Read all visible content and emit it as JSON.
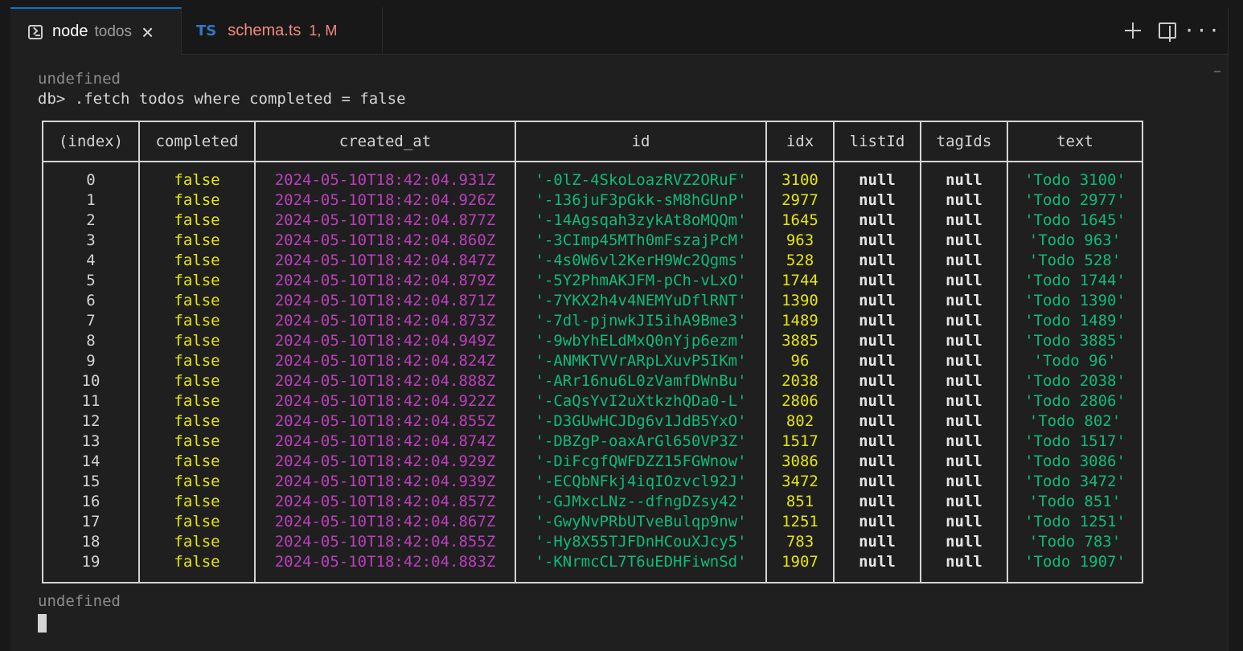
{
  "tabs": [
    {
      "title": "node",
      "description": "todos",
      "icon": "terminal-icon",
      "active": true
    },
    {
      "badge": "TS",
      "title": "schema.ts",
      "status": "1, M",
      "icon": "typescript-icon",
      "active": false
    }
  ],
  "actions": {
    "new": "new-terminal-icon",
    "split": "split-editor-icon",
    "more": "more-actions-icon"
  },
  "terminal": {
    "line1": "undefined",
    "command_line": "db> .fetch todos where completed = false",
    "result_line": "undefined",
    "table": {
      "headers": [
        "(index)",
        "completed",
        "created_at",
        "id",
        "idx",
        "listId",
        "tagIds",
        "text"
      ],
      "rows": [
        [
          "0",
          "false",
          "2024-05-10T18:42:04.931Z",
          "'-0lZ-4SkoLoazRVZ2ORuF'",
          "3100",
          "null",
          "null",
          "'Todo 3100'"
        ],
        [
          "1",
          "false",
          "2024-05-10T18:42:04.926Z",
          "'-136juF3pGkk-sM8hGUnP'",
          "2977",
          "null",
          "null",
          "'Todo 2977'"
        ],
        [
          "2",
          "false",
          "2024-05-10T18:42:04.877Z",
          "'-14Agsqah3zykAt8oMQQm'",
          "1645",
          "null",
          "null",
          "'Todo 1645'"
        ],
        [
          "3",
          "false",
          "2024-05-10T18:42:04.860Z",
          "'-3CImp45MTh0mFszajPcM'",
          "963",
          "null",
          "null",
          "'Todo 963'"
        ],
        [
          "4",
          "false",
          "2024-05-10T18:42:04.847Z",
          "'-4s0W6vl2KerH9Wc2Qgms'",
          "528",
          "null",
          "null",
          "'Todo 528'"
        ],
        [
          "5",
          "false",
          "2024-05-10T18:42:04.879Z",
          "'-5Y2PhmAKJFM-pCh-vLxO'",
          "1744",
          "null",
          "null",
          "'Todo 1744'"
        ],
        [
          "6",
          "false",
          "2024-05-10T18:42:04.871Z",
          "'-7YKX2h4v4NEMYuDflRNT'",
          "1390",
          "null",
          "null",
          "'Todo 1390'"
        ],
        [
          "7",
          "false",
          "2024-05-10T18:42:04.873Z",
          "'-7dl-pjnwkJI5ihA9Bme3'",
          "1489",
          "null",
          "null",
          "'Todo 1489'"
        ],
        [
          "8",
          "false",
          "2024-05-10T18:42:04.949Z",
          "'-9wbYhELdMxQ0nYjp6ezm'",
          "3885",
          "null",
          "null",
          "'Todo 3885'"
        ],
        [
          "9",
          "false",
          "2024-05-10T18:42:04.824Z",
          "'-ANMKTVVrARpLXuvP5IKm'",
          "96",
          "null",
          "null",
          "'Todo 96'"
        ],
        [
          "10",
          "false",
          "2024-05-10T18:42:04.888Z",
          "'-ARr16nu6L0zVamfDWnBu'",
          "2038",
          "null",
          "null",
          "'Todo 2038'"
        ],
        [
          "11",
          "false",
          "2024-05-10T18:42:04.922Z",
          "'-CaQsYvI2uXtkzhQDa0-L'",
          "2806",
          "null",
          "null",
          "'Todo 2806'"
        ],
        [
          "12",
          "false",
          "2024-05-10T18:42:04.855Z",
          "'-D3GUwHCJDg6v1JdB5YxO'",
          "802",
          "null",
          "null",
          "'Todo 802'"
        ],
        [
          "13",
          "false",
          "2024-05-10T18:42:04.874Z",
          "'-DBZgP-oaxArGl650VP3Z'",
          "1517",
          "null",
          "null",
          "'Todo 1517'"
        ],
        [
          "14",
          "false",
          "2024-05-10T18:42:04.929Z",
          "'-DiFcgfQWFDZZ15FGWnow'",
          "3086",
          "null",
          "null",
          "'Todo 3086'"
        ],
        [
          "15",
          "false",
          "2024-05-10T18:42:04.939Z",
          "'-ECQbNFkj4iqIOzvcl92J'",
          "3472",
          "null",
          "null",
          "'Todo 3472'"
        ],
        [
          "16",
          "false",
          "2024-05-10T18:42:04.857Z",
          "'-GJMxcLNz--dfngDZsy42'",
          "851",
          "null",
          "null",
          "'Todo 851'"
        ],
        [
          "17",
          "false",
          "2024-05-10T18:42:04.867Z",
          "'-GwyNvPRbUTveBulqp9nw'",
          "1251",
          "null",
          "null",
          "'Todo 1251'"
        ],
        [
          "18",
          "false",
          "2024-05-10T18:42:04.855Z",
          "'-Hy8X55TJFDnHCouXJcy5'",
          "783",
          "null",
          "null",
          "'Todo 783'"
        ],
        [
          "19",
          "false",
          "2024-05-10T18:42:04.883Z",
          "'-KNrmcCL7T6uEDHFiwnSd'",
          "1907",
          "null",
          "null",
          "'Todo 1907'"
        ]
      ]
    }
  },
  "colors": {
    "accent": "#0078d4",
    "boolean": "#e5e510",
    "date": "#bc3fbc",
    "string": "#0dbc79",
    "number": "#e5e510",
    "modified": "#f38a80"
  }
}
